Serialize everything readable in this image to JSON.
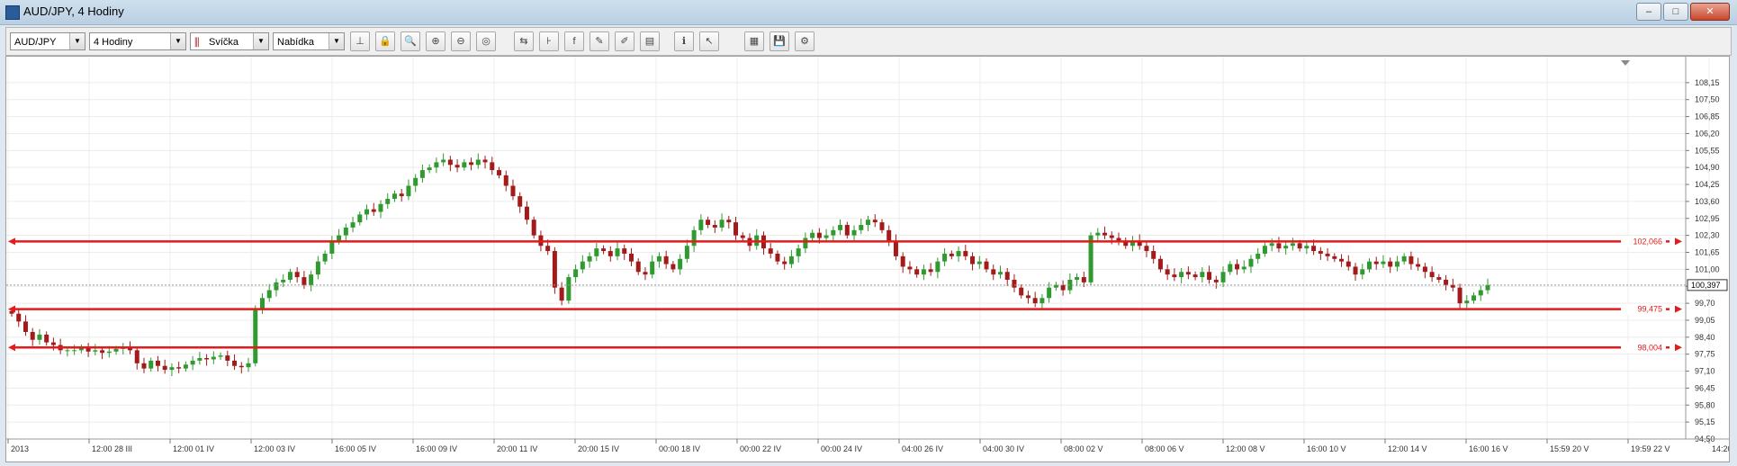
{
  "window": {
    "title": "AUD/JPY,  4 Hodiny",
    "buttons": [
      "–",
      "□",
      "✕"
    ]
  },
  "toolbar": {
    "symbol": "AUD/JPY",
    "timeframe": "4 Hodiny",
    "chart_type": "Svíčka",
    "price_side": "Nabídka",
    "icons": [
      "crosshair-icon",
      "lock-icon",
      "zoom-in-icon",
      "zoom-plus-icon",
      "zoom-minus-icon",
      "zoom-fit-icon",
      "scroll-left-icon",
      "axis-icon",
      "formula-icon",
      "indicator-icon",
      "drawing-icon",
      "notepad-icon",
      "info-icon",
      "cursor-icon",
      "grid-icon",
      "save-icon",
      "settings-icon"
    ]
  },
  "chart_data": {
    "type": "candlestick",
    "symbol": "AUD/JPY",
    "ylim": [
      94.5,
      108.8
    ],
    "y_ticks": [
      "108,15",
      "107,50",
      "106,85",
      "106,20",
      "105,55",
      "104,90",
      "104,25",
      "103,60",
      "102,95",
      "102,30",
      "101,65",
      "101,00",
      "100,35",
      "99,70",
      "99,05",
      "98,40",
      "97,75",
      "97,10",
      "96,45",
      "95,80",
      "95,15",
      "94,50"
    ],
    "x_ticks": [
      "2013",
      "12:00 28 III",
      "12:00 01 IV",
      "12:00 03 IV",
      "16:00 05 IV",
      "16:00 09 IV",
      "20:00 11 IV",
      "20:00 15 IV",
      "00:00 18 IV",
      "00:00 22 IV",
      "00:00 24 IV",
      "04:00 26 IV",
      "04:00 30 IV",
      "08:00 02 V",
      "08:00 06 V",
      "12:00 08 V",
      "16:00 10 V",
      "12:00 14 V",
      "16:00 16 V",
      "15:59 20 V",
      "19:59 22 V",
      "14:20"
    ],
    "horizontal_lines": [
      {
        "value": 102.066,
        "label": "102,066",
        "color": "#e31b1b"
      },
      {
        "value": 99.475,
        "label": "99,475",
        "color": "#e31b1b"
      },
      {
        "value": 98.004,
        "label": "98,004",
        "color": "#e31b1b"
      }
    ],
    "current_price": {
      "value": 100.397,
      "label": "100,397"
    },
    "candle_colors": {
      "up": "#2f9a2f",
      "down": "#a31a1a"
    },
    "closes": [
      99.3,
      99.0,
      98.6,
      98.3,
      98.5,
      98.2,
      98.1,
      97.9,
      97.9,
      97.9,
      98.0,
      97.85,
      97.9,
      97.8,
      97.85,
      97.95,
      98.0,
      97.9,
      97.4,
      97.2,
      97.5,
      97.3,
      97.15,
      97.25,
      97.2,
      97.35,
      97.5,
      97.6,
      97.55,
      97.65,
      97.7,
      97.5,
      97.3,
      97.25,
      97.4,
      99.5,
      99.9,
      100.2,
      100.5,
      100.6,
      100.9,
      100.7,
      100.4,
      100.8,
      101.3,
      101.6,
      102.1,
      102.3,
      102.6,
      102.8,
      103.1,
      103.3,
      103.2,
      103.5,
      103.7,
      103.9,
      103.8,
      104.2,
      104.5,
      104.8,
      104.9,
      105.1,
      105.2,
      105.0,
      104.9,
      105.1,
      105.0,
      105.2,
      105.1,
      104.8,
      104.6,
      104.2,
      103.8,
      103.4,
      102.9,
      102.3,
      101.9,
      101.7,
      100.3,
      99.8,
      100.7,
      101.0,
      101.3,
      101.5,
      101.8,
      101.7,
      101.5,
      101.8,
      101.6,
      101.3,
      100.9,
      100.8,
      101.3,
      101.5,
      101.2,
      101.0,
      101.4,
      101.9,
      102.5,
      102.9,
      102.7,
      102.6,
      102.9,
      102.8,
      102.3,
      102.2,
      101.9,
      102.3,
      101.8,
      101.6,
      101.3,
      101.2,
      101.5,
      101.8,
      102.2,
      102.4,
      102.2,
      102.3,
      102.5,
      102.7,
      102.3,
      102.5,
      102.7,
      102.9,
      102.8,
      102.5,
      102.1,
      101.5,
      101.1,
      101.0,
      100.8,
      101.0,
      100.9,
      101.3,
      101.6,
      101.5,
      101.7,
      101.5,
      101.2,
      101.3,
      101.0,
      100.8,
      100.9,
      100.6,
      100.3,
      100.0,
      99.9,
      99.7,
      99.9,
      100.3,
      100.4,
      100.2,
      100.6,
      100.7,
      100.5,
      102.3,
      102.4,
      102.3,
      102.2,
      102.1,
      101.9,
      102.1,
      101.9,
      101.7,
      101.4,
      101.0,
      100.8,
      100.7,
      100.9,
      100.8,
      100.7,
      100.9,
      100.6,
      100.5,
      100.9,
      101.2,
      101.0,
      101.1,
      101.4,
      101.6,
      101.9,
      102.0,
      101.8,
      101.9,
      102.0,
      101.8,
      101.9,
      101.7,
      101.6,
      101.5,
      101.4,
      101.3,
      101.1,
      100.8,
      101.0,
      101.3,
      101.2,
      101.3,
      101.1,
      101.3,
      101.5,
      101.2,
      101.1,
      100.9,
      100.7,
      100.6,
      100.4,
      100.3,
      99.7,
      99.8,
      100.0,
      100.2,
      100.4
    ]
  }
}
